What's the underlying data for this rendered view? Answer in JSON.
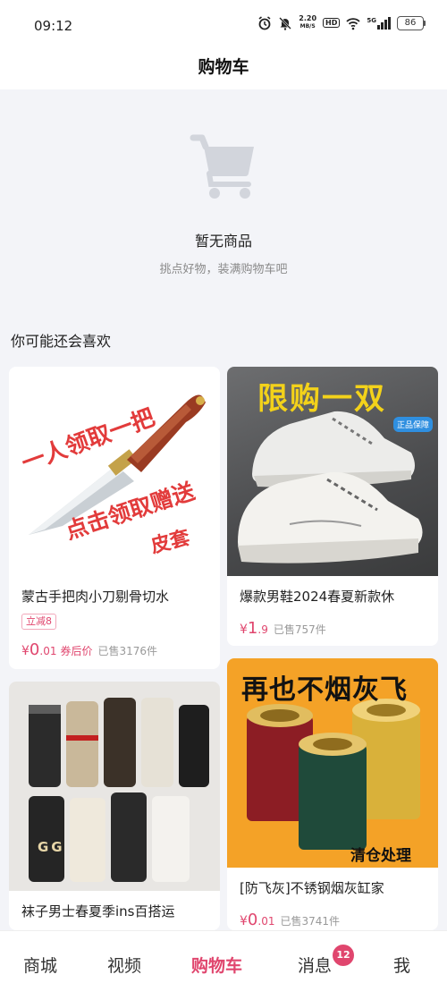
{
  "status_bar": {
    "time": "09:12",
    "net_speed_value": "2.20",
    "net_speed_unit": "MB/S",
    "hd": "HD",
    "signal_label": "5G",
    "battery": "86"
  },
  "header": {
    "title": "购物车"
  },
  "empty_state": {
    "title": "暂无商品",
    "subtitle": "挑点好物，装满购物车吧"
  },
  "recommend": {
    "title": "你可能还会喜欢",
    "products": [
      {
        "name": "蒙古手把肉小刀剔骨切水",
        "tag": "立减8",
        "price_symbol": "¥",
        "price_int": "0",
        "price_dec": ".01",
        "price_note": "券后价",
        "sold": "已售3176件",
        "image_text_1": "一人领取一把",
        "image_text_2": "点击领取赠送",
        "image_text_3": "皮套"
      },
      {
        "name": "爆款男鞋2024春夏新款休",
        "price_symbol": "¥",
        "price_int": "1",
        "price_dec": ".9",
        "sold": "已售757件",
        "image_text_1": "限购一双",
        "image_badge": "正品保障"
      },
      {
        "name": "袜子男士春夏季ins百搭运",
        "image_text_1": "GG"
      },
      {
        "name": "[防飞灰]不锈钢烟灰缸家",
        "price_symbol": "¥",
        "price_int": "0",
        "price_dec": ".01",
        "sold": "已售3741件",
        "image_text_1": "再也不烟灰飞",
        "image_text_2": "清仓处理"
      }
    ]
  },
  "nav": {
    "items": [
      "商城",
      "视频",
      "购物车",
      "消息",
      "我"
    ],
    "active": "购物车",
    "messages_badge": "12"
  },
  "colors": {
    "accent": "#e0466e",
    "background": "#f3f4f8"
  }
}
